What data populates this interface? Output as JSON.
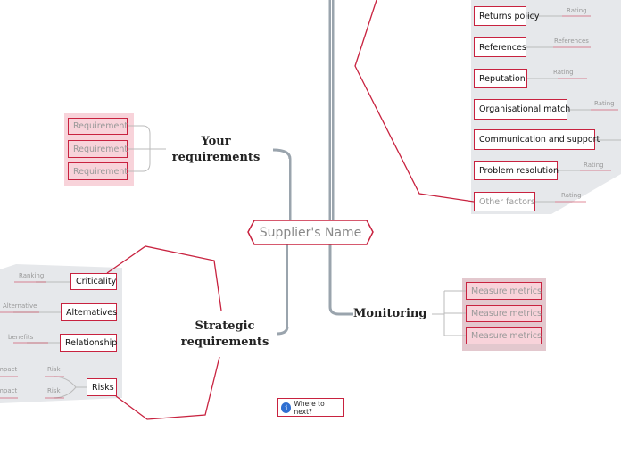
{
  "central": {
    "label": "Supplier's Name"
  },
  "topics": {
    "your_requirements": "Your\nrequirements",
    "strategic_requirements": "Strategic\nrequirements",
    "monitoring": "Monitoring"
  },
  "your_requirements": {
    "items": [
      "Requirement",
      "Requirement",
      "Requirement"
    ]
  },
  "other_factors": {
    "items": [
      {
        "label": "Returns policy",
        "sub": "Rating"
      },
      {
        "label": "References",
        "sub": "References"
      },
      {
        "label": "Reputation",
        "sub": "Rating"
      },
      {
        "label": "Organisational match",
        "sub": "Rating"
      },
      {
        "label": "Communication and support",
        "sub": ""
      },
      {
        "label": "Problem resolution",
        "sub": "Rating"
      },
      {
        "label": "Other factors",
        "sub": "Rating"
      }
    ]
  },
  "strategic": {
    "items": [
      {
        "label": "Criticality",
        "sub": "Ranking"
      },
      {
        "label": "Alternatives",
        "sub": "Alternative"
      },
      {
        "label": "Relationship",
        "sub": "benefits"
      },
      {
        "label": "Risks",
        "subs": [
          {
            "risk": "Risk",
            "impact": "Impact"
          },
          {
            "risk": "Risk",
            "impact": "Impact"
          }
        ]
      }
    ]
  },
  "monitoring": {
    "items": [
      "Measure metrics",
      "Measure metrics",
      "Measure metrics"
    ]
  },
  "where_next": {
    "label": "Where to next?",
    "icon": "info-icon"
  },
  "colors": {
    "accent": "#c8223f",
    "panel": "#e6e8eb",
    "pink": "#f8d3da"
  }
}
